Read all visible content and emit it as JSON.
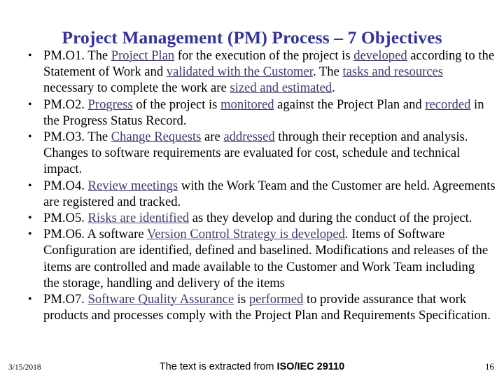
{
  "slide": {
    "title": "Project Management (PM) Process – 7 Objectives",
    "title_color": "#333399",
    "background_color": "#ffffff",
    "body_text_color": "#000000",
    "underline_color": "#3b3b6d",
    "bullet_glyph": "•"
  },
  "bullets": [
    {
      "id": "pm-o1",
      "plain": "PM.O1. The Project Plan for the execution of the project is developed according to the Statement of Work and validated with the Customer. The tasks and resources necessary to complete the work are sized and estimated.",
      "runs": [
        {
          "t": "PM.O1. The ",
          "u": false
        },
        {
          "t": "Project Plan",
          "u": true
        },
        {
          "t": " for the execution of the project is ",
          "u": false
        },
        {
          "t": "developed",
          "u": true
        },
        {
          "t": " according to the Statement of Work and ",
          "u": false
        },
        {
          "t": "validated with the Customer",
          "u": true
        },
        {
          "t": ". The ",
          "u": false
        },
        {
          "t": "tasks and resources",
          "u": true
        },
        {
          "t": " necessary to complete the work are ",
          "u": false
        },
        {
          "t": "sized and estimated",
          "u": true
        },
        {
          "t": ".",
          "u": false
        }
      ]
    },
    {
      "id": "pm-o2",
      "plain": "PM.O2. Progress of the project is monitored against the Project Plan and recorded in the Progress Status Record.",
      "runs": [
        {
          "t": "PM.O2. ",
          "u": false
        },
        {
          "t": "Progress",
          "u": true
        },
        {
          "t": " of the project is ",
          "u": false
        },
        {
          "t": "monitored",
          "u": true
        },
        {
          "t": " against the Project Plan and ",
          "u": false
        },
        {
          "t": "recorded",
          "u": true
        },
        {
          "t": " in the Progress Status Record.",
          "u": false
        }
      ]
    },
    {
      "id": "pm-o3",
      "plain": "PM.O3. The Change Requests are addressed through their reception and analysis. Changes to software requirements are evaluated for cost, schedule and technical impact.",
      "runs": [
        {
          "t": "PM.O3. The ",
          "u": false
        },
        {
          "t": "Change Requests",
          "u": true
        },
        {
          "t": " are ",
          "u": false
        },
        {
          "t": "addressed",
          "u": true
        },
        {
          "t": " through their reception and analysis. Changes to software requirements are evaluated for cost, schedule and technical impact.",
          "u": false
        }
      ]
    },
    {
      "id": "pm-o4",
      "plain": "PM.O4. Review meetings with the Work Team and the Customer are held. Agreements are registered and tracked.",
      "runs": [
        {
          "t": "PM.O4. ",
          "u": false
        },
        {
          "t": "Review meetings",
          "u": true
        },
        {
          "t": " with the Work Team and the Customer are held. Agreements are registered and tracked.",
          "u": false
        }
      ]
    },
    {
      "id": "pm-o5",
      "plain": "PM.O5. Risks are identified as they develop and during the conduct of the project.",
      "runs": [
        {
          "t": "PM.O5. ",
          "u": false
        },
        {
          "t": "Risks are identified",
          "u": true
        },
        {
          "t": " as they develop and during the conduct of the project.",
          "u": false
        }
      ]
    },
    {
      "id": "pm-o6",
      "plain": "PM.O6. A software Version Control Strategy is developed. Items of Software Configuration are identified, defined and baselined. Modifications and releases of the items are controlled and made available to the Customer and Work Team including  the storage, handling and delivery of the items",
      "runs": [
        {
          "t": "PM.O6. A software ",
          "u": false
        },
        {
          "t": "Version Control Strategy is developed",
          "u": true
        },
        {
          "t": ". Items of Software Configuration are identified, defined and baselined. Modifications and releases of the items are controlled and made available to the Customer and Work Team including  the storage, handling and delivery of the items",
          "u": false
        }
      ]
    },
    {
      "id": "pm-o7",
      "plain": "PM.O7. Software Quality Assurance is performed to provide assurance that work products and processes comply with the Project Plan and Requirements Specification.",
      "runs": [
        {
          "t": "PM.O7. ",
          "u": false
        },
        {
          "t": "Software Quality Assurance",
          "u": true
        },
        {
          "t": " is ",
          "u": false
        },
        {
          "t": "performed",
          "u": true
        },
        {
          "t": " to provide assurance that work products and processes comply with the Project Plan and Requirements Specification.",
          "u": false
        }
      ]
    }
  ],
  "footer": {
    "date": "3/15/2018",
    "note_prefix": "The text is extracted from ",
    "note_emphasis": "ISO/IEC 29110",
    "page_number": "16"
  }
}
